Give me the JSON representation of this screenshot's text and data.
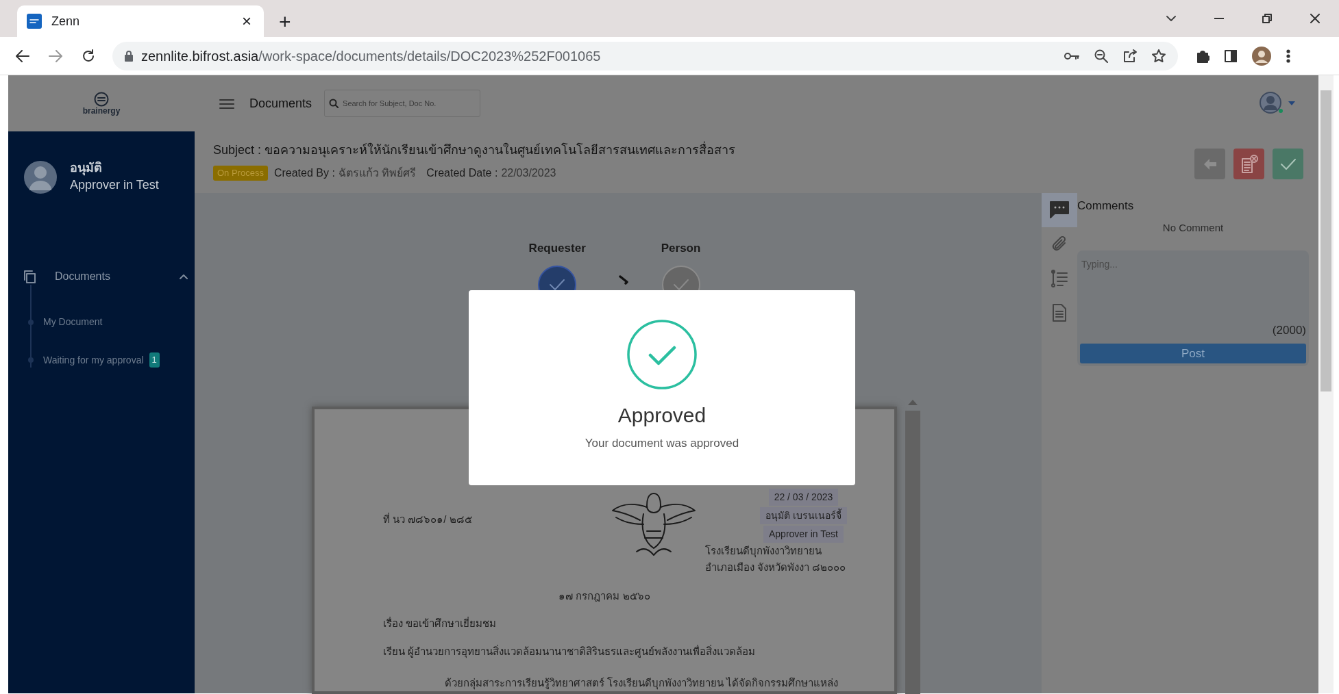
{
  "browser": {
    "tab": {
      "title": "Zenn",
      "close": "×"
    },
    "new_tab": "+",
    "url_host": "zennlite.bifrost.asia",
    "url_path": "/work-space/documents/details/DOC2023%252F001065"
  },
  "header": {
    "logo": "brainergy",
    "title": "Documents",
    "search": {
      "placeholder": "Search for Subject, Doc No."
    }
  },
  "sidebar": {
    "user": {
      "name": "อนุมัติ",
      "role": "Approver in Test"
    },
    "items": [
      {
        "label": "Documents",
        "expanded": true,
        "children": [
          {
            "label": "My Document"
          },
          {
            "label": "Waiting for my approval",
            "badge": "1"
          }
        ]
      }
    ]
  },
  "document": {
    "subject": "Subject : ขอความอนุเคราะห์ให้นักเรียนเข้าศึกษาดูงานในศูนย์เทคโนโลยีสารสนเทศและการสื่อสาร",
    "status": {
      "label": "On Process",
      "color": "#8a6d00"
    },
    "created_by_label": "Created By :",
    "created_by": "ฉัตรแก้ว ทิพย์ศรี",
    "created_date_label": "Created Date :",
    "created_date": "22/03/2023",
    "actions": [
      {
        "kind": "back"
      },
      {
        "kind": "reject"
      },
      {
        "kind": "approve"
      }
    ],
    "workflow": [
      {
        "label": "Requester",
        "done": true
      },
      {
        "label": "Person",
        "done": false
      }
    ],
    "page": {
      "ref": "ที่ นว ๗๘๖๐๑/ ๒๘๕",
      "address": [
        "โรงเรียนดีบุกพังงาวิทยายน",
        "อำเภอเมือง จังหวัดพังงา ๘๒๐๐๐"
      ],
      "date": "๑๗ กรกฎาคม ๒๕๖๐",
      "lines": [
        "เรื่อง  ขอเข้าศึกษาเยี่ยมชม",
        "เรียน  ผู้อำนวยการอุทยานสิ่งแวดล้อมนานาชาติสิรินธรและศูนย์พลังงานเพื่อสิ่งแวดล้อม"
      ],
      "paragraph": "ด้วยกลุ่มสาระการเรียนรู้วิทยาศาสตร์ โรงเรียนดีบุกพังงาวิทยายน ได้จัดกิจกรรมศึกษาแหล่ง",
      "stamp": [
        "22 / 03 / 2023",
        "อนุมัติ เบรนเนอร์จี้",
        "Approver in Test"
      ]
    }
  },
  "tools": [
    {
      "kind": "comments",
      "selected": true
    },
    {
      "kind": "attachment",
      "selected": false
    },
    {
      "kind": "timeline",
      "selected": false
    },
    {
      "kind": "file",
      "selected": false
    }
  ],
  "comments": {
    "title": "Comments",
    "empty": "No Comment",
    "placeholder": "Typing...",
    "counter": "(2000)",
    "post": "Post"
  },
  "modal": {
    "title": "Approved",
    "message": "Your document was approved"
  }
}
